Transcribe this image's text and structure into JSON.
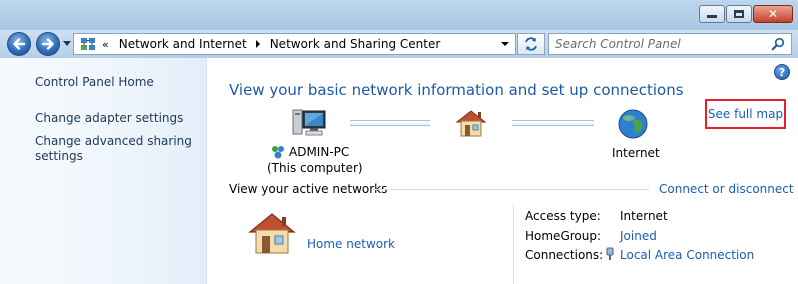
{
  "window": {
    "caption_buttons": {
      "minimize": "minimize-icon",
      "maximize": "maximize-icon",
      "close": "close-icon"
    }
  },
  "nav": {
    "back_icon": "back-arrow-icon",
    "forward_icon": "forward-arrow-icon",
    "breadcrumb_overflow": "«",
    "breadcrumbs": [
      "Network and Internet",
      "Network and Sharing Center"
    ],
    "search_placeholder": "Search Control Panel"
  },
  "sidebar": {
    "items": [
      {
        "label": "Control Panel Home"
      },
      {
        "label": "Change adapter settings"
      },
      {
        "label": "Change advanced sharing settings",
        "line1": "Change advanced sharing",
        "line2": "settings"
      }
    ]
  },
  "main": {
    "help_icon": "help-icon",
    "heading": "View your basic network information and set up connections",
    "see_full_map": "See full map",
    "computer": {
      "name": "ADMIN-PC",
      "subtitle": "(This computer)"
    },
    "internet_label": "Internet",
    "active_networks_title": "View your active networks",
    "connect_link": "Connect or disconnect",
    "network": {
      "name": "Home network",
      "properties": [
        {
          "label": "Access type:",
          "value": "Internet",
          "is_link": false
        },
        {
          "label": "HomeGroup:",
          "value": "Joined",
          "is_link": true
        },
        {
          "label": "Connections:",
          "value": "Local Area Connection",
          "is_link": true
        }
      ]
    }
  },
  "colors": {
    "link": "#1a5fb4",
    "heading": "#1e5ba6",
    "highlight_box": "#e8202a"
  }
}
